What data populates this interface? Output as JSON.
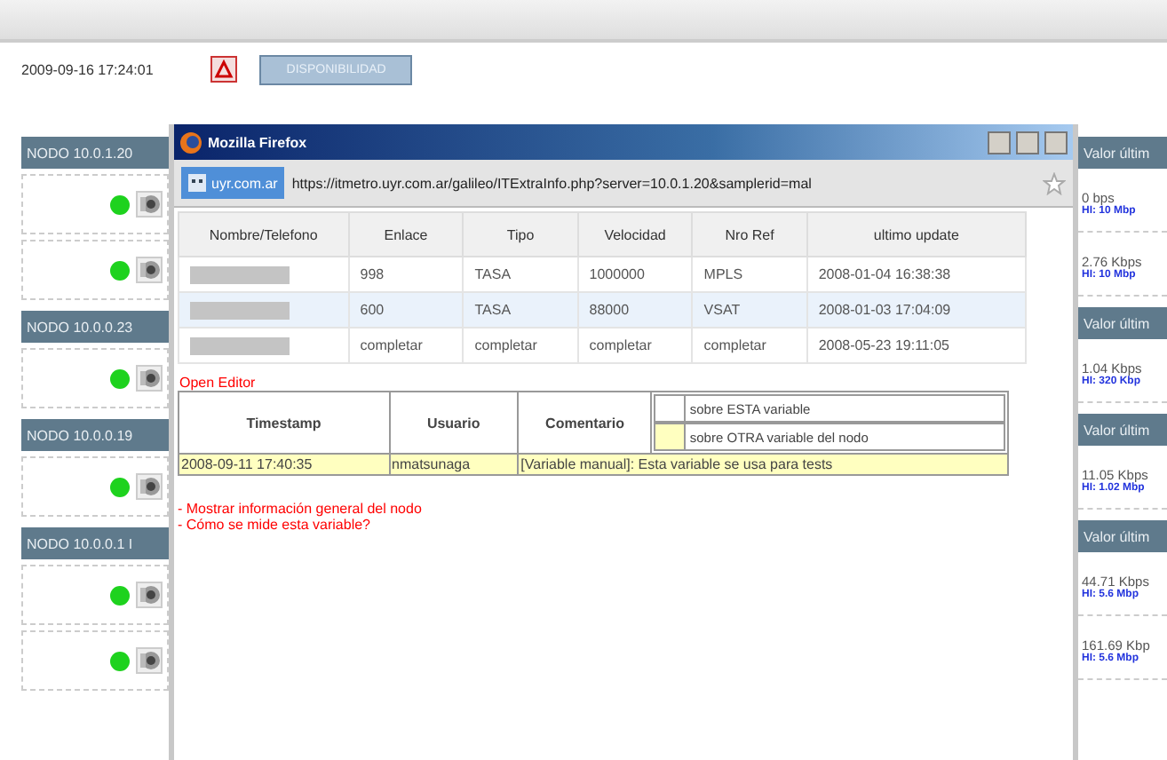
{
  "header": {
    "datetime": "2009-09-16 17:24:01",
    "button": "DISPONIBILIDAD"
  },
  "nodes": [
    {
      "name": "NODO 10.0.1.20",
      "value_header": "Valor últim",
      "rows": [
        {
          "value": "0 bps",
          "hi": "HI: 10 Mbp"
        },
        {
          "value": "2.76 Kbps",
          "hi": "HI: 10 Mbp"
        }
      ]
    },
    {
      "name": "NODO 10.0.0.23",
      "value_header": "Valor últim",
      "rows": [
        {
          "value": "1.04 Kbps",
          "hi": "HI: 320 Kbp"
        }
      ]
    },
    {
      "name": "NODO 10.0.0.19",
      "value_header": "Valor últim",
      "rows": [
        {
          "value": "11.05 Kbps",
          "hi": "HI: 1.02 Mbp"
        }
      ]
    },
    {
      "name": "NODO 10.0.0.1 I",
      "value_header": "Valor últim",
      "rows": [
        {
          "value": "44.71 Kbps",
          "hi": "HI: 5.6 Mbp"
        },
        {
          "value": "161.69 Kbp",
          "hi": "HI: 5.6 Mbp"
        }
      ]
    }
  ],
  "popup": {
    "title": "Mozilla Firefox",
    "site": "uyr.com.ar",
    "url": "https://itmetro.uyr.com.ar/galileo/ITExtraInfo.php?server=10.0.1.20&samplerid=mal",
    "links_table": {
      "columns": [
        "Nombre/Telefono",
        "Enlace",
        "Tipo",
        "Velocidad",
        "Nro Ref",
        "ultimo update"
      ],
      "rows": [
        {
          "selected": false,
          "cells": [
            "",
            "998",
            "TASA",
            "1000000",
            "MPLS",
            "2008-01-04 16:38:38"
          ]
        },
        {
          "selected": true,
          "cells": [
            "",
            "600",
            "TASA",
            "88000",
            "VSAT",
            "2008-01-03 17:04:09"
          ]
        },
        {
          "selected": false,
          "cells": [
            "",
            "completar",
            "completar",
            "completar",
            "completar",
            "2008-05-23 19:11:05"
          ]
        }
      ]
    },
    "open_editor": "Open Editor",
    "comments_table": {
      "columns": [
        "Timestamp",
        "Usuario",
        "Comentario"
      ],
      "options": [
        {
          "label": "sobre ESTA variable",
          "color": "#ffffff"
        },
        {
          "label": "sobre OTRA variable del nodo",
          "color": "#ffffc0"
        }
      ],
      "rows": [
        {
          "cells": [
            "2008-09-11 17:40:35",
            "nmatsunaga",
            "[Variable manual]: Esta variable se usa para tests"
          ]
        }
      ]
    },
    "links": [
      "- Mostrar información general del nodo",
      "- Cómo se mide esta variable?"
    ]
  }
}
